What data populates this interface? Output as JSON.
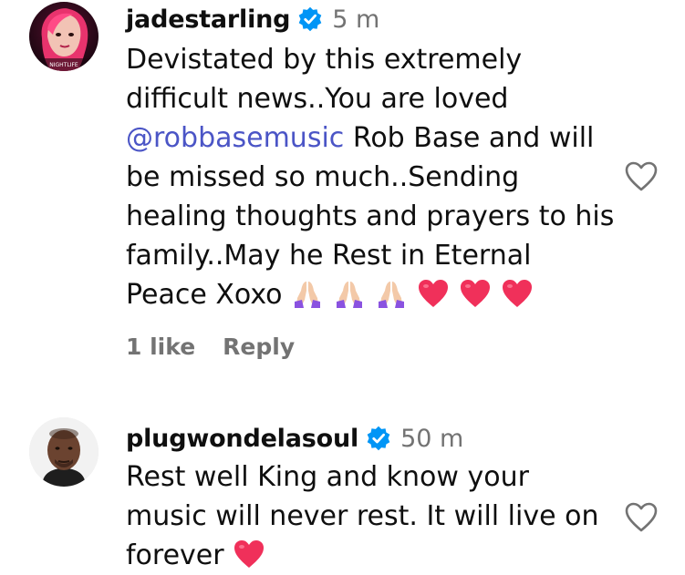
{
  "comments": [
    {
      "username": "jadestarling",
      "time": "5 m",
      "text_parts": [
        "Devistated by this extremely difficult news..You are loved ",
        "@robbasemusic",
        " Rob Base and will be missed so much..Sending healing thoughts and prayers to his family..May he Rest in Eternal Peace Xoxo "
      ],
      "emojis": [
        "folded-hands-emoji",
        "folded-hands-emoji",
        "folded-hands-emoji",
        "red-heart-emoji",
        "red-heart-emoji",
        "red-heart-emoji"
      ],
      "likes_label": "1 like",
      "reply_label": "Reply",
      "avatar_text": "NIGHTLIFE"
    },
    {
      "username": "plugwondelasoul",
      "time": "50 m",
      "text_parts": [
        "Rest well King and know your music will never rest. It will live on forever "
      ],
      "emojis": [
        "red-heart-emoji"
      ]
    }
  ],
  "colors": {
    "verified": "#0095f6",
    "mention": "#4b55c6",
    "muted": "#737373",
    "heart_emoji": "#f0305a"
  }
}
